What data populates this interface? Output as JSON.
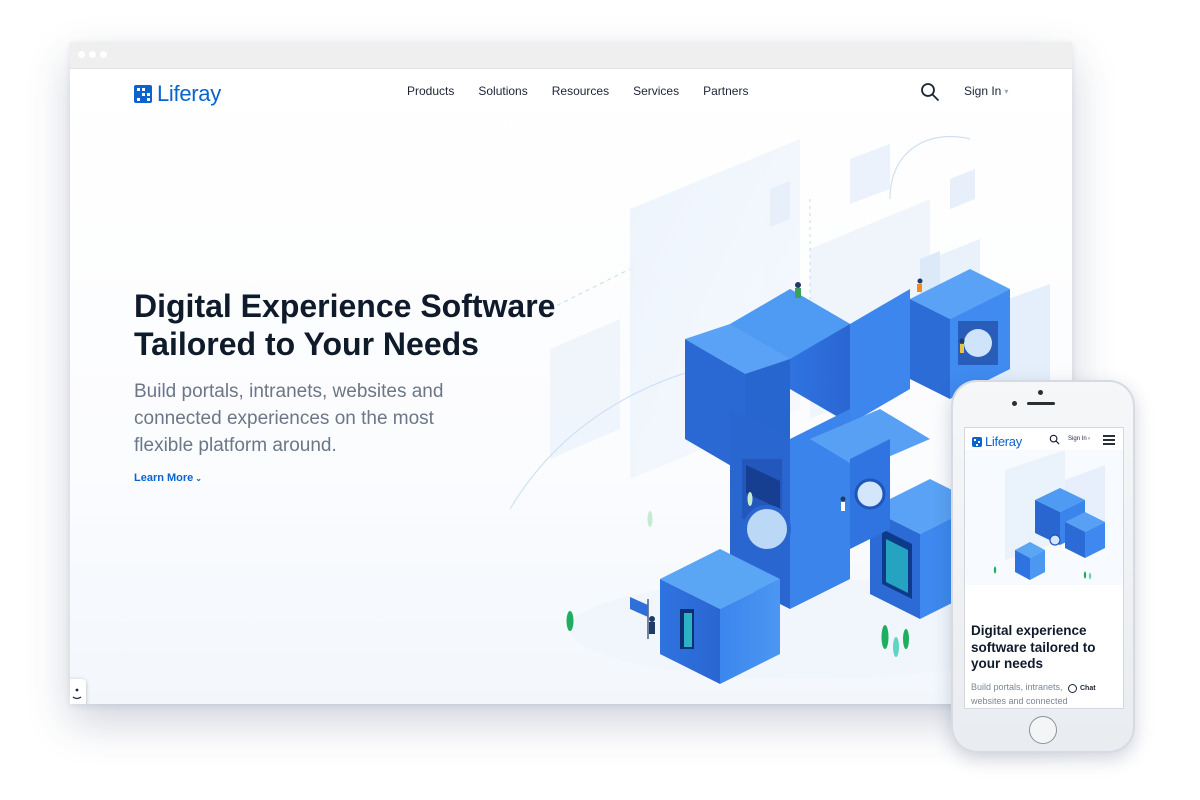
{
  "desktop": {
    "brand": "Liferay",
    "nav": [
      "Products",
      "Solutions",
      "Resources",
      "Services",
      "Partners"
    ],
    "search_icon": "search-icon",
    "signin_label": "Sign In",
    "hero": {
      "title_line1": "Digital Experience Software",
      "title_line2": "Tailored to Your Needs",
      "subtitle_line1": "Build portals, intranets, websites and",
      "subtitle_line2": "connected experiences on the most",
      "subtitle_line3": "flexible platform around.",
      "cta": "Learn More"
    }
  },
  "mobile": {
    "brand": "Liferay",
    "signin_label": "Sign In",
    "menu_icon": "hamburger-menu-icon",
    "title_line1": "Digital experience",
    "title_line2": "software tailored to",
    "title_line3": "your needs",
    "subtitle_line1": "Build portals, intranets,",
    "subtitle_line2": "websites and connected",
    "chat_label": "Chat"
  },
  "colors": {
    "brand_blue": "#0b63ce",
    "cube_blue": "#2f7ee6",
    "heading": "#0f1a2b",
    "subtext": "#6b7788"
  }
}
